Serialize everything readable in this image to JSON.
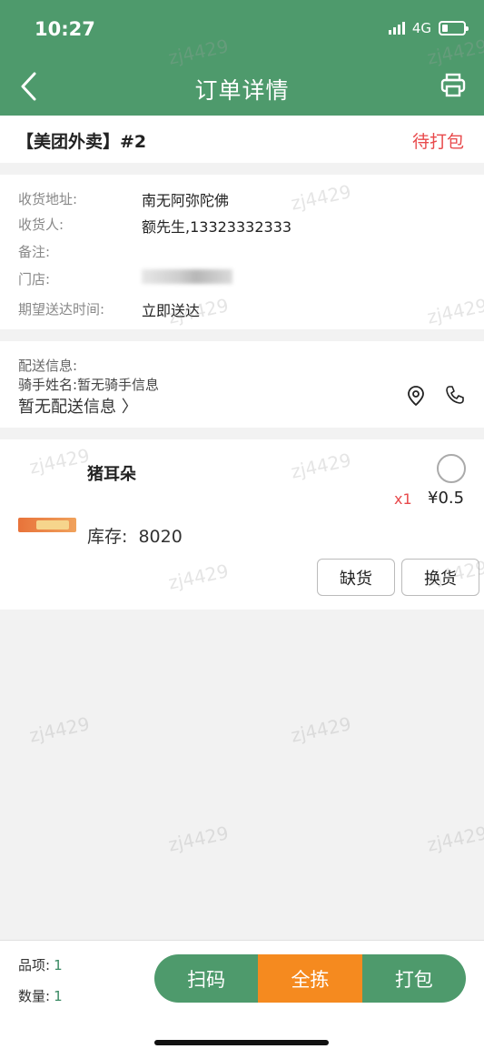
{
  "status_bar": {
    "time": "10:27",
    "network": "4G"
  },
  "nav": {
    "title": "订单详情",
    "back_icon": "chevron-left-icon",
    "print_icon": "printer-icon"
  },
  "order": {
    "source": "【美团外卖】#2",
    "status": "待打包"
  },
  "info": {
    "address_label": "收货地址:",
    "address_value": "南无阿弥陀佛",
    "receiver_label": "收货人:",
    "receiver_value": "额先生,13323332333",
    "note_label": "备注:",
    "note_value": "",
    "store_label": "门店:",
    "expected_label": "期望送达时间:",
    "expected_value": "立即送达"
  },
  "delivery": {
    "label": "配送信息:",
    "rider": "骑手姓名:暂无骑手信息",
    "none": "暂无配送信息 〉",
    "location_icon": "map-pin-icon",
    "phone_icon": "phone-icon"
  },
  "product": {
    "name": "猪耳朵",
    "qty": "x1",
    "price": "¥0.5",
    "stock_label": "库存:",
    "stock_value": "8020",
    "btn_out_of_stock": "缺货",
    "btn_replace": "换货"
  },
  "watermark": "zj4429",
  "footer": {
    "items_label": "品项:",
    "items_value": "1",
    "qty_label": "数量:",
    "qty_value": "1",
    "scan": "扫码",
    "pick_all": "全拣",
    "pack": "打包"
  },
  "colors": {
    "primary": "#4e9a6c",
    "accent": "#f58a1f",
    "alert": "#e8494b"
  }
}
